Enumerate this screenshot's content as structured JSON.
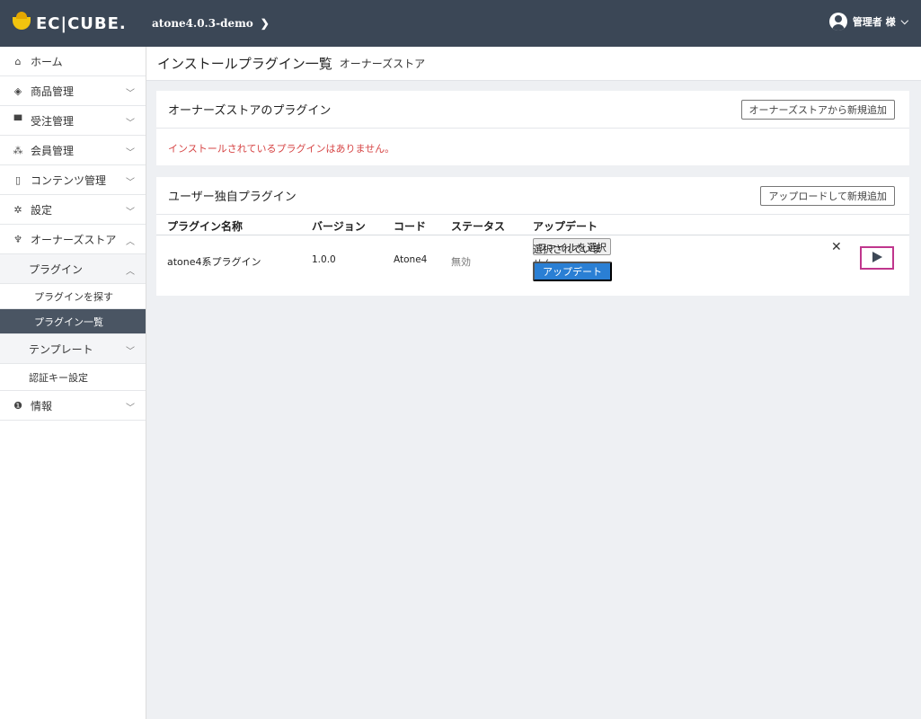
{
  "header": {
    "logo_text": "EC|CUBE.",
    "shop_name": "atone4.0.3-demo",
    "user_name": "管理者 様"
  },
  "sidebar": {
    "items": [
      {
        "label": "ホーム",
        "icon": "home-icon"
      },
      {
        "label": "商品管理",
        "icon": "box-icon"
      },
      {
        "label": "受注管理",
        "icon": "cart-icon"
      },
      {
        "label": "会員管理",
        "icon": "users-icon"
      },
      {
        "label": "コンテンツ管理",
        "icon": "document-icon"
      },
      {
        "label": "設定",
        "icon": "gear-icon"
      },
      {
        "label": "オーナーズストア",
        "icon": "plug-icon"
      },
      {
        "label": "情報",
        "icon": "info-icon"
      }
    ],
    "owners_store_sub": {
      "plugin": "プラグイン",
      "plugin_search": "プラグインを探す",
      "plugin_list": "プラグイン一覧",
      "template": "テンプレート",
      "auth_key": "認証キー設定"
    }
  },
  "page": {
    "title": "インストールプラグイン一覧",
    "subtitle": "オーナーズストア"
  },
  "owners_card": {
    "title": "オーナーズストアのプラグイン",
    "add_button": "オーナーズストアから新規追加",
    "empty_message": "インストールされているプラグインはありません。"
  },
  "user_card": {
    "title": "ユーザー独自プラグイン",
    "upload_button": "アップロードして新規追加",
    "columns": [
      "プラグイン名称",
      "バージョン",
      "コード",
      "ステータス",
      "アップデート"
    ],
    "row": {
      "name": "atone4系プラグイン",
      "version": "1.0.0",
      "code": "Atone4",
      "status": "無効",
      "file_button": "ファイルを選択",
      "file_status": "選択されていません",
      "update_button": "アップデート"
    }
  },
  "colors": {
    "header_bg": "#3b4756",
    "active_nav_bg": "#4a5563",
    "primary": "#2a7fd4",
    "error_text": "#d64545",
    "highlight_border": "#c0368d"
  }
}
